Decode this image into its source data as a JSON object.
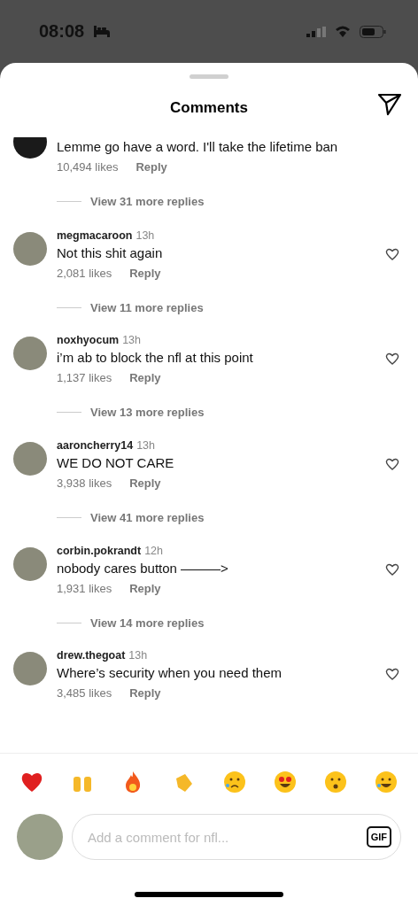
{
  "status_bar": {
    "time": "08:08"
  },
  "header": {
    "title": "Comments"
  },
  "comments": [
    {
      "text": "Lemme go have a word. I'll take the lifetime ban",
      "likes": "10,494 likes",
      "reply": "Reply",
      "replies": "View 31 more replies"
    },
    {
      "username": "megmacaroon",
      "time": "13h",
      "text": "Not this shit again",
      "likes": "2,081 likes",
      "reply": "Reply",
      "replies": "View 11 more replies",
      "liked": false
    },
    {
      "username": "noxhyocum",
      "time": "13h",
      "text": "i’m ab to block the nfl at this point",
      "likes": "1,137 likes",
      "reply": "Reply",
      "replies": "View 13 more replies",
      "liked": false
    },
    {
      "username": "aaroncherry14",
      "time": "13h",
      "text": "WE DO NOT CARE",
      "likes": "3,938 likes",
      "reply": "Reply",
      "replies": "View 41 more replies",
      "liked": false
    },
    {
      "username": "corbin.pokrandt",
      "time": "12h",
      "text": "nobody cares button ———>",
      "likes": "1,931 likes",
      "reply": "Reply",
      "replies": "View 14 more replies",
      "liked": false
    },
    {
      "username": "drew.thegoat",
      "time": "13h",
      "text": "Where’s security when you need them",
      "likes": "3,485 likes",
      "reply": "Reply",
      "liked": false
    }
  ],
  "reactions": [
    {
      "kind": "heart"
    },
    {
      "kind": "raised-hands"
    },
    {
      "kind": "fire"
    },
    {
      "kind": "clap"
    },
    {
      "kind": "crying"
    },
    {
      "kind": "heart-eyes"
    },
    {
      "kind": "surprised"
    },
    {
      "kind": "laughing"
    }
  ],
  "composer": {
    "placeholder": "Add a comment for nfl...",
    "gif": "GIF"
  }
}
